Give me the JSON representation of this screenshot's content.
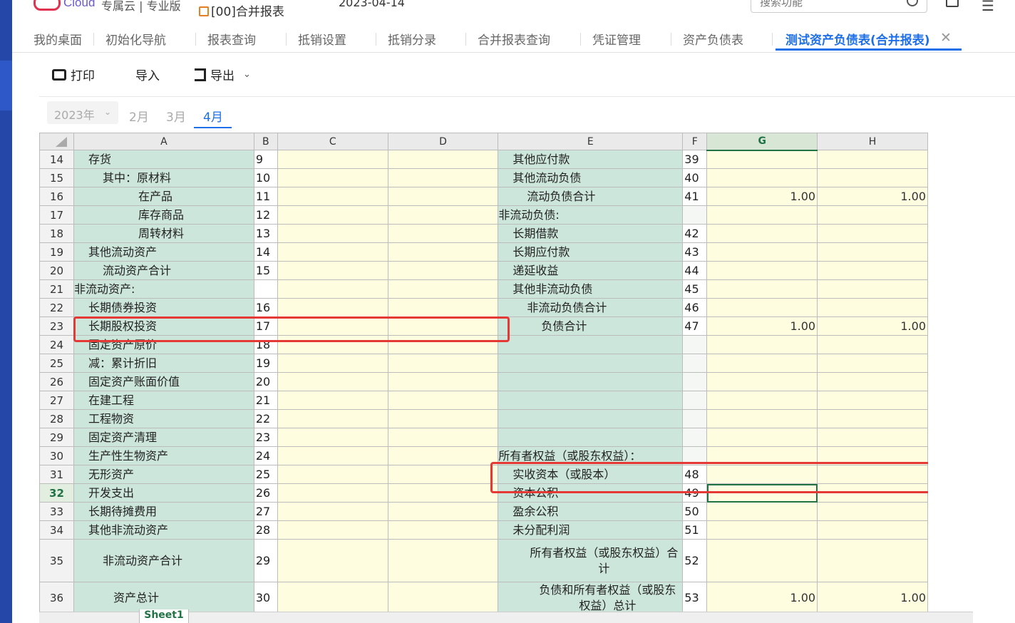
{
  "header": {
    "brand": "Cloud",
    "edition": "专属云 | 专业版",
    "org": "[00]合并报表",
    "date": "2023-04-14",
    "search_placeholder": "搜索功能"
  },
  "tabs": [
    "我的桌面",
    "初始化导航",
    "报表查询",
    "抵销设置",
    "抵销分录",
    "合并报表查询",
    "凭证管理",
    "资产负债表",
    "测试资产负债表(合并报表)"
  ],
  "toolbar": {
    "print": "打印",
    "import": "导入",
    "export": "导出"
  },
  "periods": {
    "year": "2023年",
    "months": [
      "2月",
      "3月",
      "4月"
    ],
    "active": "4月"
  },
  "columns": [
    "A",
    "B",
    "C",
    "D",
    "E",
    "F",
    "G",
    "H"
  ],
  "rows": [
    {
      "n": "14",
      "a": "存货",
      "b": "9",
      "e": "其他应付款",
      "f": "39",
      "g": "",
      "h": ""
    },
    {
      "n": "15",
      "a": "其中：原材料",
      "b": "10",
      "e": "其他流动负债",
      "f": "40",
      "g": "",
      "h": ""
    },
    {
      "n": "16",
      "a": "在产品",
      "b": "11",
      "e": "流动负债合计",
      "f": "41",
      "g": "1.00",
      "h": "1.00"
    },
    {
      "n": "17",
      "a": "库存商品",
      "b": "12",
      "e": "非流动负债:",
      "f": "",
      "g": "",
      "h": ""
    },
    {
      "n": "18",
      "a": "周转材料",
      "b": "13",
      "e": "长期借款",
      "f": "42",
      "g": "",
      "h": ""
    },
    {
      "n": "19",
      "a": "其他流动资产",
      "b": "14",
      "e": "长期应付款",
      "f": "43",
      "g": "",
      "h": ""
    },
    {
      "n": "20",
      "a": "流动资产合计",
      "b": "15",
      "e": "递延收益",
      "f": "44",
      "g": "",
      "h": ""
    },
    {
      "n": "21",
      "a": "非流动资产:",
      "b": "",
      "e": "其他非流动负债",
      "f": "45",
      "g": "",
      "h": ""
    },
    {
      "n": "22",
      "a": "长期债券投资",
      "b": "16",
      "e": "非流动负债合计",
      "f": "46",
      "g": "",
      "h": ""
    },
    {
      "n": "23",
      "a": "长期股权投资",
      "b": "17",
      "e": "负债合计",
      "f": "47",
      "g": "1.00",
      "h": "1.00"
    },
    {
      "n": "24",
      "a": "固定资产原价",
      "b": "18",
      "e": "",
      "f": "",
      "g": "",
      "h": ""
    },
    {
      "n": "25",
      "a": "减：累计折旧",
      "b": "19",
      "e": "",
      "f": "",
      "g": "",
      "h": ""
    },
    {
      "n": "26",
      "a": "固定资产账面价值",
      "b": "20",
      "e": "",
      "f": "",
      "g": "",
      "h": ""
    },
    {
      "n": "27",
      "a": "在建工程",
      "b": "21",
      "e": "",
      "f": "",
      "g": "",
      "h": ""
    },
    {
      "n": "28",
      "a": "工程物资",
      "b": "22",
      "e": "",
      "f": "",
      "g": "",
      "h": ""
    },
    {
      "n": "29",
      "a": "固定资产清理",
      "b": "23",
      "e": "",
      "f": "",
      "g": "",
      "h": ""
    },
    {
      "n": "30",
      "a": "生产性生物资产",
      "b": "24",
      "e": "所有者权益（或股东权益）：",
      "f": "",
      "g": "",
      "h": ""
    },
    {
      "n": "31",
      "a": "无形资产",
      "b": "25",
      "e": "实收资本（或股本）",
      "f": "48",
      "g": "",
      "h": ""
    },
    {
      "n": "32",
      "a": "开发支出",
      "b": "26",
      "e": "资本公积",
      "f": "49",
      "g": "",
      "h": ""
    },
    {
      "n": "33",
      "a": "长期待摊费用",
      "b": "27",
      "e": "盈余公积",
      "f": "50",
      "g": "",
      "h": ""
    },
    {
      "n": "34",
      "a": "其他非流动资产",
      "b": "28",
      "e": "未分配利润",
      "f": "51",
      "g": "",
      "h": ""
    },
    {
      "n": "35",
      "a": "非流动资产合计",
      "b": "29",
      "e": "所有者权益（或股东权益）合计",
      "f": "52",
      "g": "",
      "h": ""
    },
    {
      "n": "36",
      "a": "资产总计",
      "b": "30",
      "e": "负债和所有者权益（或股东权益）总计",
      "f": "53",
      "g": "1.00",
      "h": "1.00"
    }
  ],
  "sheet_tab": "Sheet1",
  "selected_column": "G",
  "selected_row": "32"
}
